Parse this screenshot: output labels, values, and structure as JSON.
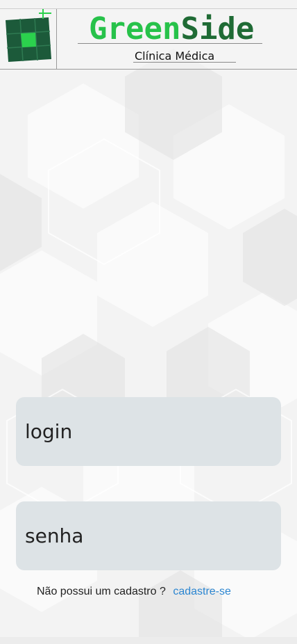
{
  "header": {
    "logo_icon": "clinic-grid-logo",
    "brand_part1": "Green",
    "brand_part2": "Side",
    "subtitle": "Clínica Médica",
    "colors": {
      "brand_light": "#27c24a",
      "brand_dark": "#1f6b35"
    }
  },
  "form": {
    "login_placeholder": "login",
    "password_placeholder": "senha",
    "field_color": "#dde3e6"
  },
  "signup": {
    "prompt": "Não possui um cadastro ?",
    "link_label": "cadastre-se",
    "link_color": "#2c86d1"
  }
}
